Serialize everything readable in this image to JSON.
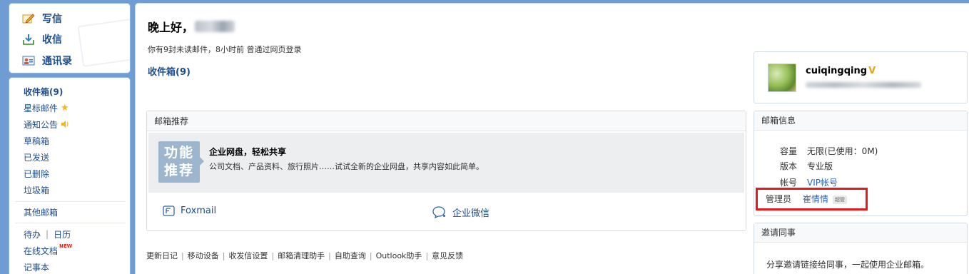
{
  "sidebar": {
    "compose": {
      "write_label": "写信",
      "receive_label": "收信",
      "contacts_label": "通讯录"
    },
    "folders": {
      "inbox": "收件箱(9)",
      "starred": "星标邮件",
      "notices": "通知公告",
      "drafts": "草稿箱",
      "sent": "已发送",
      "deleted": "已删除",
      "spam": "垃圾箱",
      "other_mailboxes": "其他邮箱",
      "todo": "待办",
      "todo_sep": "|",
      "calendar": "日历",
      "online_docs": "在线文档",
      "new_badge": "NEW",
      "notebook": "记事本"
    }
  },
  "main": {
    "greeting": "晚上好，",
    "unread_info": "你有9封未读邮件，8小时前 曾通过网页登录",
    "inbox_link": "收件箱(9)",
    "recommend": {
      "title": "邮箱推荐",
      "tile_line1": "功能",
      "tile_line2": "推荐",
      "feature_title": "企业网盘，轻松共享",
      "feature_desc": "公司文档、产品资料、旅行照片……试试全新的企业网盘，共享内容如此简单。",
      "foxmail": "Foxmail",
      "wechat_work": "企业微信"
    },
    "footer_links": [
      "更新日记",
      "移动设备",
      "收发信设置",
      "邮箱清理助手",
      "自助查询",
      "Outlook助手",
      "意见反馈"
    ]
  },
  "profile": {
    "username": "cuiqingqing",
    "vip_mark": "V"
  },
  "mailbox_info": {
    "title": "邮箱信息",
    "capacity_label": "容量",
    "capacity_value": "无限(已使用：0M)",
    "edition_label": "版本",
    "edition_value": "专业版",
    "account_label": "帐号",
    "account_value": "VIP帐号",
    "admin_label": "管理员",
    "admin_value": "崔情情",
    "admin_badge": "超管"
  },
  "invite": {
    "title": "邀请同事",
    "text": "分享邀请链接给同事，一起使用企业邮箱。"
  },
  "colors": {
    "background": "#6e9cd3",
    "link": "#1f4d8a",
    "highlight": "#e8191d",
    "vip": "#e6a318"
  }
}
